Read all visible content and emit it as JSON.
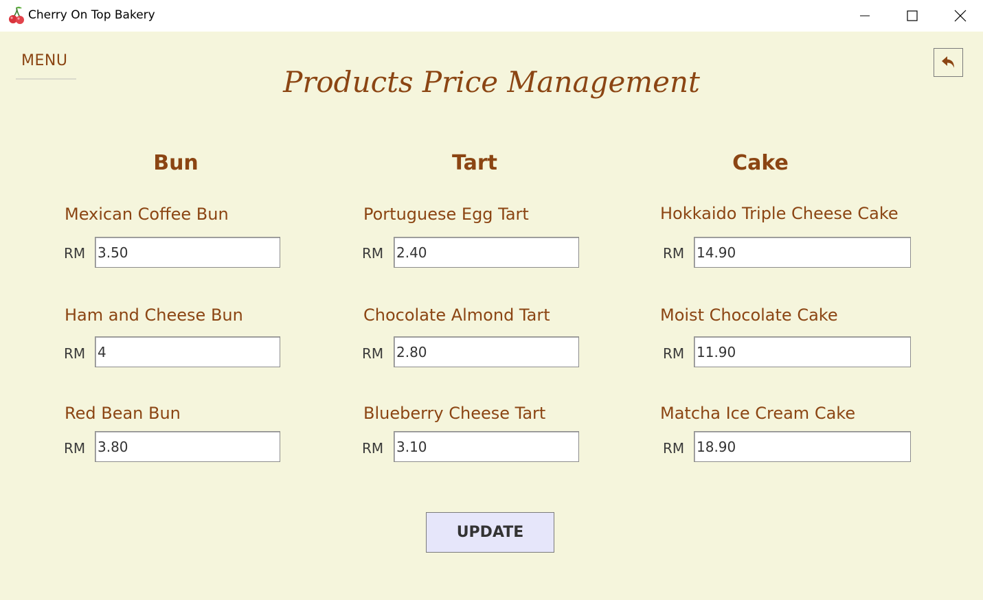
{
  "window": {
    "title": "Cherry On Top Bakery",
    "app_icon": "cherry-icon",
    "controls": [
      "minimize-icon",
      "maximize-icon",
      "close-icon"
    ]
  },
  "header": {
    "menu_label": "MENU",
    "page_title": "Products Price Management",
    "back_icon": "reply-arrow-icon"
  },
  "currency_label": "RM",
  "categories": [
    {
      "name": "Bun",
      "products": [
        {
          "name": "Mexican Coffee Bun",
          "price": "3.50"
        },
        {
          "name": "Ham and Cheese Bun",
          "price": "4"
        },
        {
          "name": "Red Bean Bun",
          "price": "3.80"
        }
      ]
    },
    {
      "name": "Tart",
      "products": [
        {
          "name": "Portuguese Egg Tart",
          "price": "2.40"
        },
        {
          "name": "Chocolate Almond Tart",
          "price": "2.80"
        },
        {
          "name": "Blueberry Cheese Tart",
          "price": "3.10"
        }
      ]
    },
    {
      "name": "Cake",
      "products": [
        {
          "name": "Hokkaido Triple Cheese Cake",
          "price": "14.90"
        },
        {
          "name": "Moist Chocolate Cake",
          "price": "11.90"
        },
        {
          "name": "Matcha Ice Cream Cake",
          "price": "18.90"
        }
      ]
    }
  ],
  "update_label": "UPDATE",
  "colors": {
    "background": "#f5f5dc",
    "accent_brown": "#8b4513",
    "button_lavender": "#e6e6fa"
  }
}
